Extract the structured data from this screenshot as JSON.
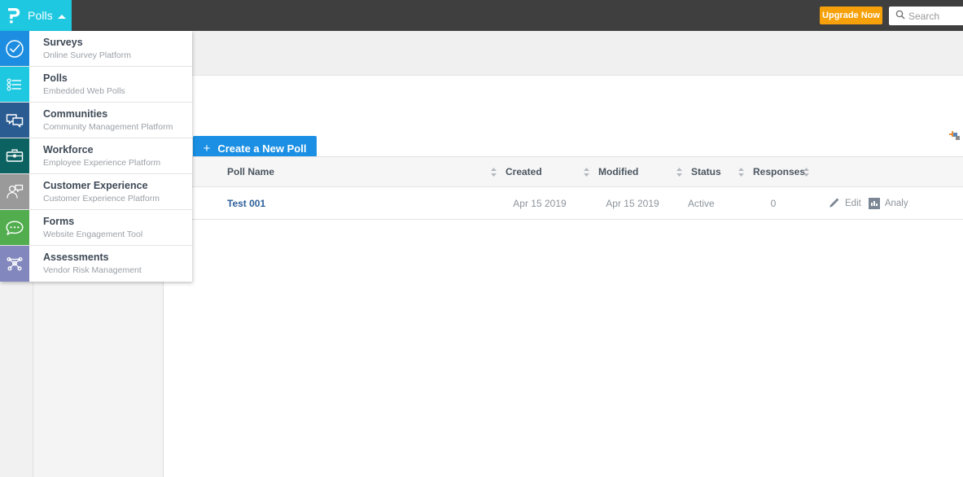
{
  "topbar": {
    "brand_name": "Polls",
    "logo_icon": "question-p-logo",
    "caret_icon": "caret-up-icon",
    "upgrade_label": "Upgrade Now",
    "search_placeholder": "Search",
    "search_value": "",
    "search_icon": "search-icon",
    "bg_color": "#3f3f3f",
    "brand_bg_color": "#1ec8e0",
    "upgrade_color": "#f6a10a"
  },
  "app_switcher": {
    "items": [
      {
        "title": "Surveys",
        "subtitle": "Online Survey Platform",
        "icon": "check-circle-icon",
        "color": "#1c8de0"
      },
      {
        "title": "Polls",
        "subtitle": "Embedded Web Polls",
        "icon": "poll-list-icon",
        "color": "#1ec8e0"
      },
      {
        "title": "Communities",
        "subtitle": "Community Management Platform",
        "icon": "speech-bubbles-icon",
        "color": "#2b5c91"
      },
      {
        "title": "Workforce",
        "subtitle": "Employee Experience Platform",
        "icon": "briefcase-icon",
        "color": "#0c6161"
      },
      {
        "title": "Customer Experience",
        "subtitle": "Customer Experience Platform",
        "icon": "person-speech-icon",
        "color": "#9a9a9a"
      },
      {
        "title": "Forms",
        "subtitle": "Website Engagement Tool",
        "icon": "chat-dots-icon",
        "color": "#52ad4e"
      },
      {
        "title": "Assessments",
        "subtitle": "Vendor Risk Management",
        "icon": "network-nodes-icon",
        "color": "#8288bd"
      }
    ]
  },
  "toolbar": {
    "create_label": "Create a New Poll",
    "create_plus": "+",
    "create_color": "#1a8fe3",
    "corner_icon": "add-widget-icon"
  },
  "table": {
    "select_all_icon": "checkbox-unchecked",
    "sort_icon": "sort-arrows-icon",
    "columns": [
      {
        "label": "Poll Name",
        "sortable": false
      },
      {
        "label": "Created",
        "sortable": true
      },
      {
        "label": "Modified",
        "sortable": true
      },
      {
        "label": "Status",
        "sortable": true
      },
      {
        "label": "Responses",
        "sortable": true
      }
    ],
    "rows": [
      {
        "checkbox_icon": "checkbox-unchecked",
        "name": "Test 001",
        "created": "Apr 15 2019",
        "modified": "Apr 15 2019",
        "status": "Active",
        "responses": "0",
        "actions": [
          {
            "label": "Edit",
            "icon": "pencil-icon"
          },
          {
            "label": "Analy",
            "icon": "bar-chart-icon"
          }
        ]
      }
    ]
  }
}
